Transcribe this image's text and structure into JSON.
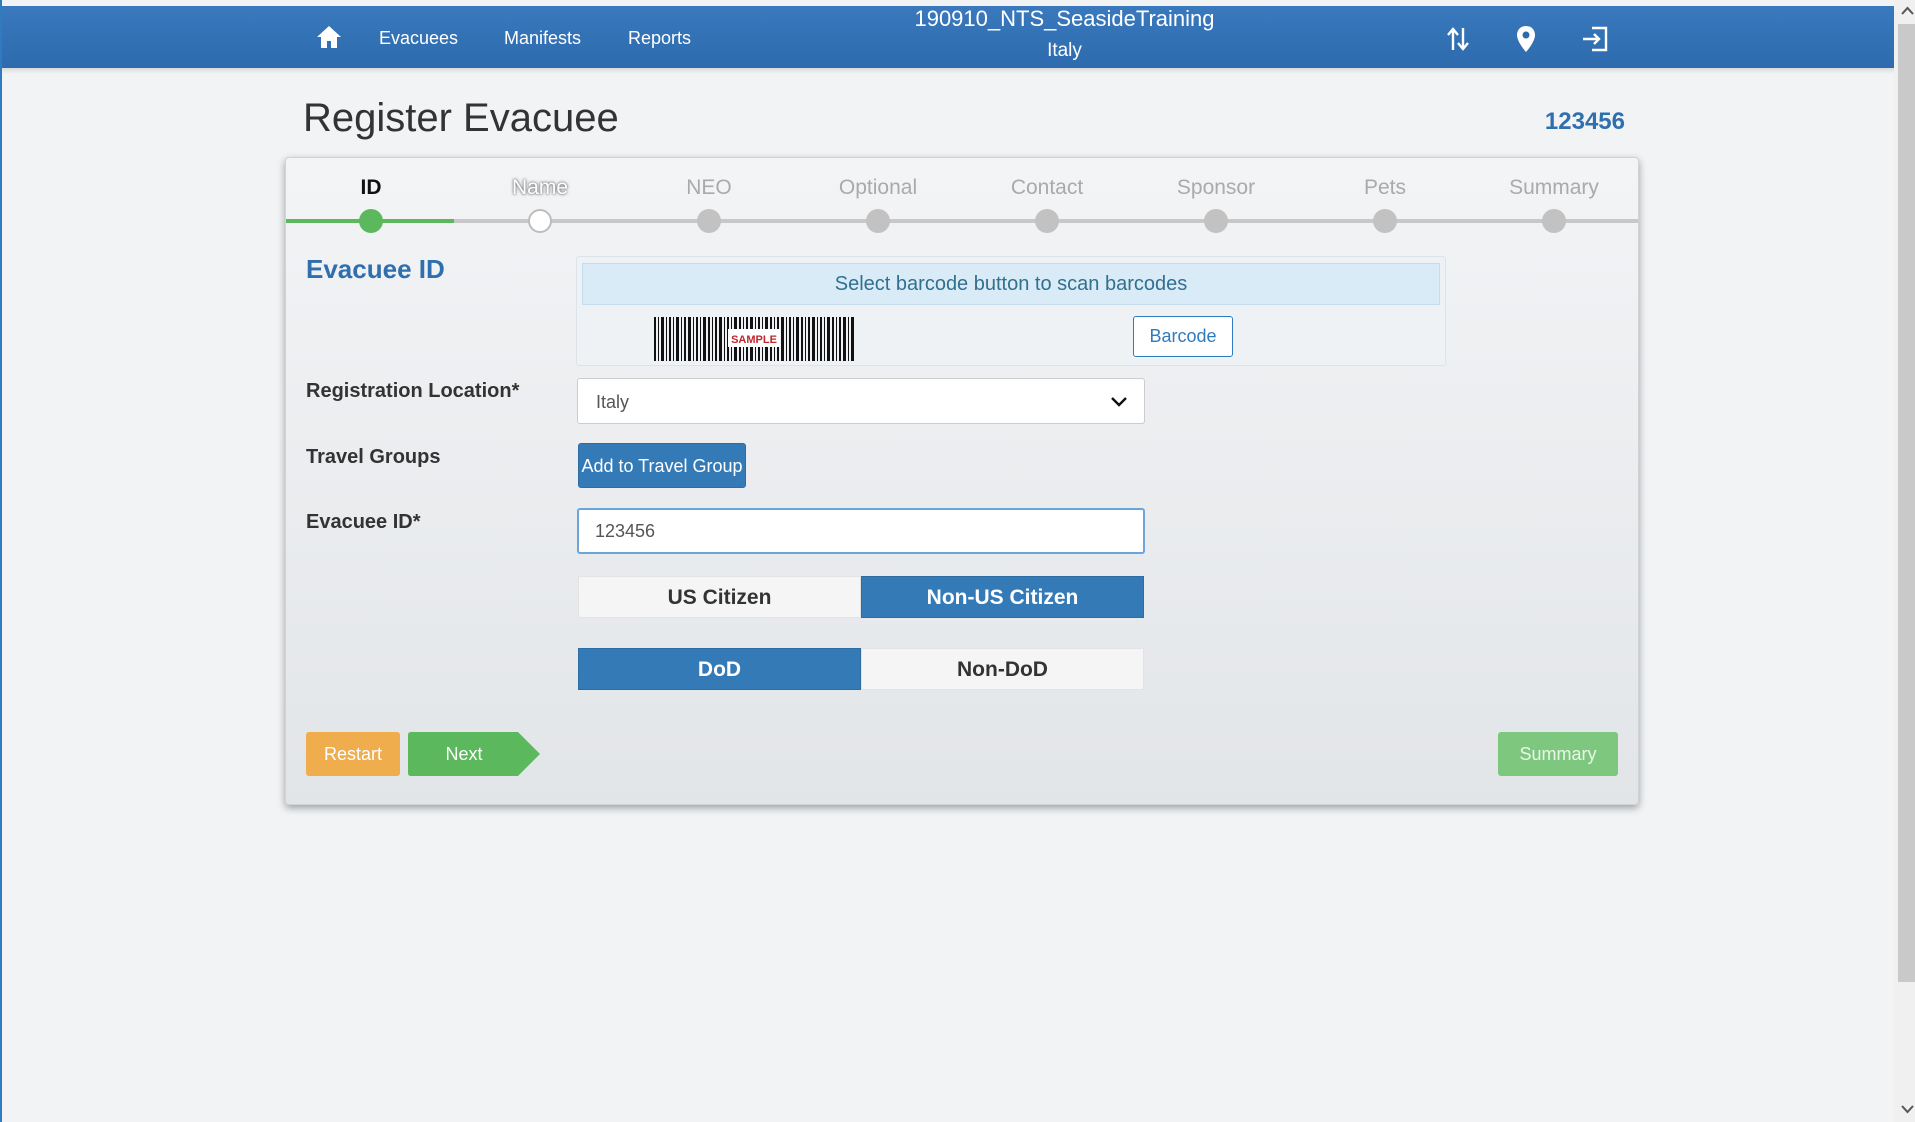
{
  "nav": {
    "links": [
      "Evacuees",
      "Manifests",
      "Reports"
    ],
    "title": "190910_NTS_SeasideTraining",
    "subtitle": "Italy"
  },
  "page": {
    "title": "Register Evacuee",
    "evacuee_id_display": "123456"
  },
  "steps": [
    "ID",
    "Name",
    "NEO",
    "Optional",
    "Contact",
    "Sponsor",
    "Pets",
    "Summary"
  ],
  "form": {
    "section_title": "Evacuee ID",
    "barcode_hint": "Select barcode button to scan barcodes",
    "barcode_sample_text": "SAMPLE",
    "barcode_button": "Barcode",
    "registration_location_label": "Registration Location*",
    "registration_location_value": "Italy",
    "travel_groups_label": "Travel Groups",
    "add_travel_group_button": "Add to Travel Group",
    "evacuee_id_label": "Evacuee ID*",
    "evacuee_id_value": "123456",
    "citizenship_options": [
      "US Citizen",
      "Non-US Citizen"
    ],
    "citizenship_selected": "Non-US Citizen",
    "dod_options": [
      "DoD",
      "Non-DoD"
    ],
    "dod_selected": "DoD"
  },
  "actions": {
    "restart": "Restart",
    "next": "Next",
    "summary": "Summary"
  },
  "colors": {
    "nav_blue": "#2d6aae",
    "primary": "#337ab7",
    "success": "#5cb85c",
    "warning": "#f0ad4e"
  }
}
